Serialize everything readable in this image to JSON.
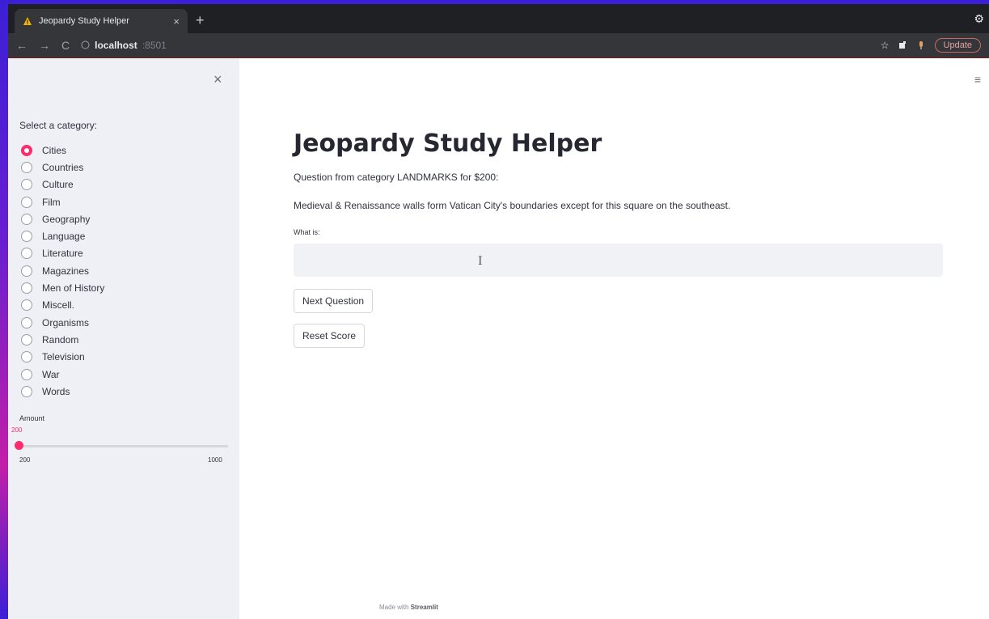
{
  "browser": {
    "tab_title": "Jeopardy Study Helper",
    "close_tab_glyph": "×",
    "new_tab_glyph": "+",
    "url_host": "localhost",
    "url_port": ":8501",
    "update_label": "Update",
    "nav_back": "←",
    "nav_forward": "→",
    "nav_reload": "C",
    "star_glyph": "☆",
    "settings_glyph": "⚙",
    "icons": [
      "warning-favicon-icon",
      "star-icon",
      "extensions-icon",
      "mic-icon",
      "menu-dots-icon"
    ]
  },
  "sidebar": {
    "close_glyph": "×",
    "category_label": "Select a category:",
    "categories": [
      "Cities",
      "Countries",
      "Culture",
      "Film",
      "Geography",
      "Language",
      "Literature",
      "Magazines",
      "Men of History",
      "Miscell.",
      "Organisms",
      "Random",
      "Television",
      "War",
      "Words"
    ],
    "selected_index": 0,
    "amount": {
      "label": "Amount",
      "value": "200",
      "min": "200",
      "max": "1000"
    }
  },
  "main": {
    "menu_glyph": "≡",
    "title": "Jeopardy Study Helper",
    "question_header": "Question from category LANDMARKS for $200:",
    "question_text": "Medieval & Renaissance walls form Vatican City's boundaries except for this square on the southeast.",
    "input_label": "What is:",
    "input_value": "",
    "input_cursor_glyph": "I",
    "next_button": "Next Question",
    "reset_button": "Reset Score",
    "footer_prefix": "Made with",
    "footer_brand": "Streamlit"
  },
  "colors": {
    "accent": "#ff2b6b",
    "sidebar_bg": "#eff0f5",
    "input_bg": "#f0f2f6"
  }
}
